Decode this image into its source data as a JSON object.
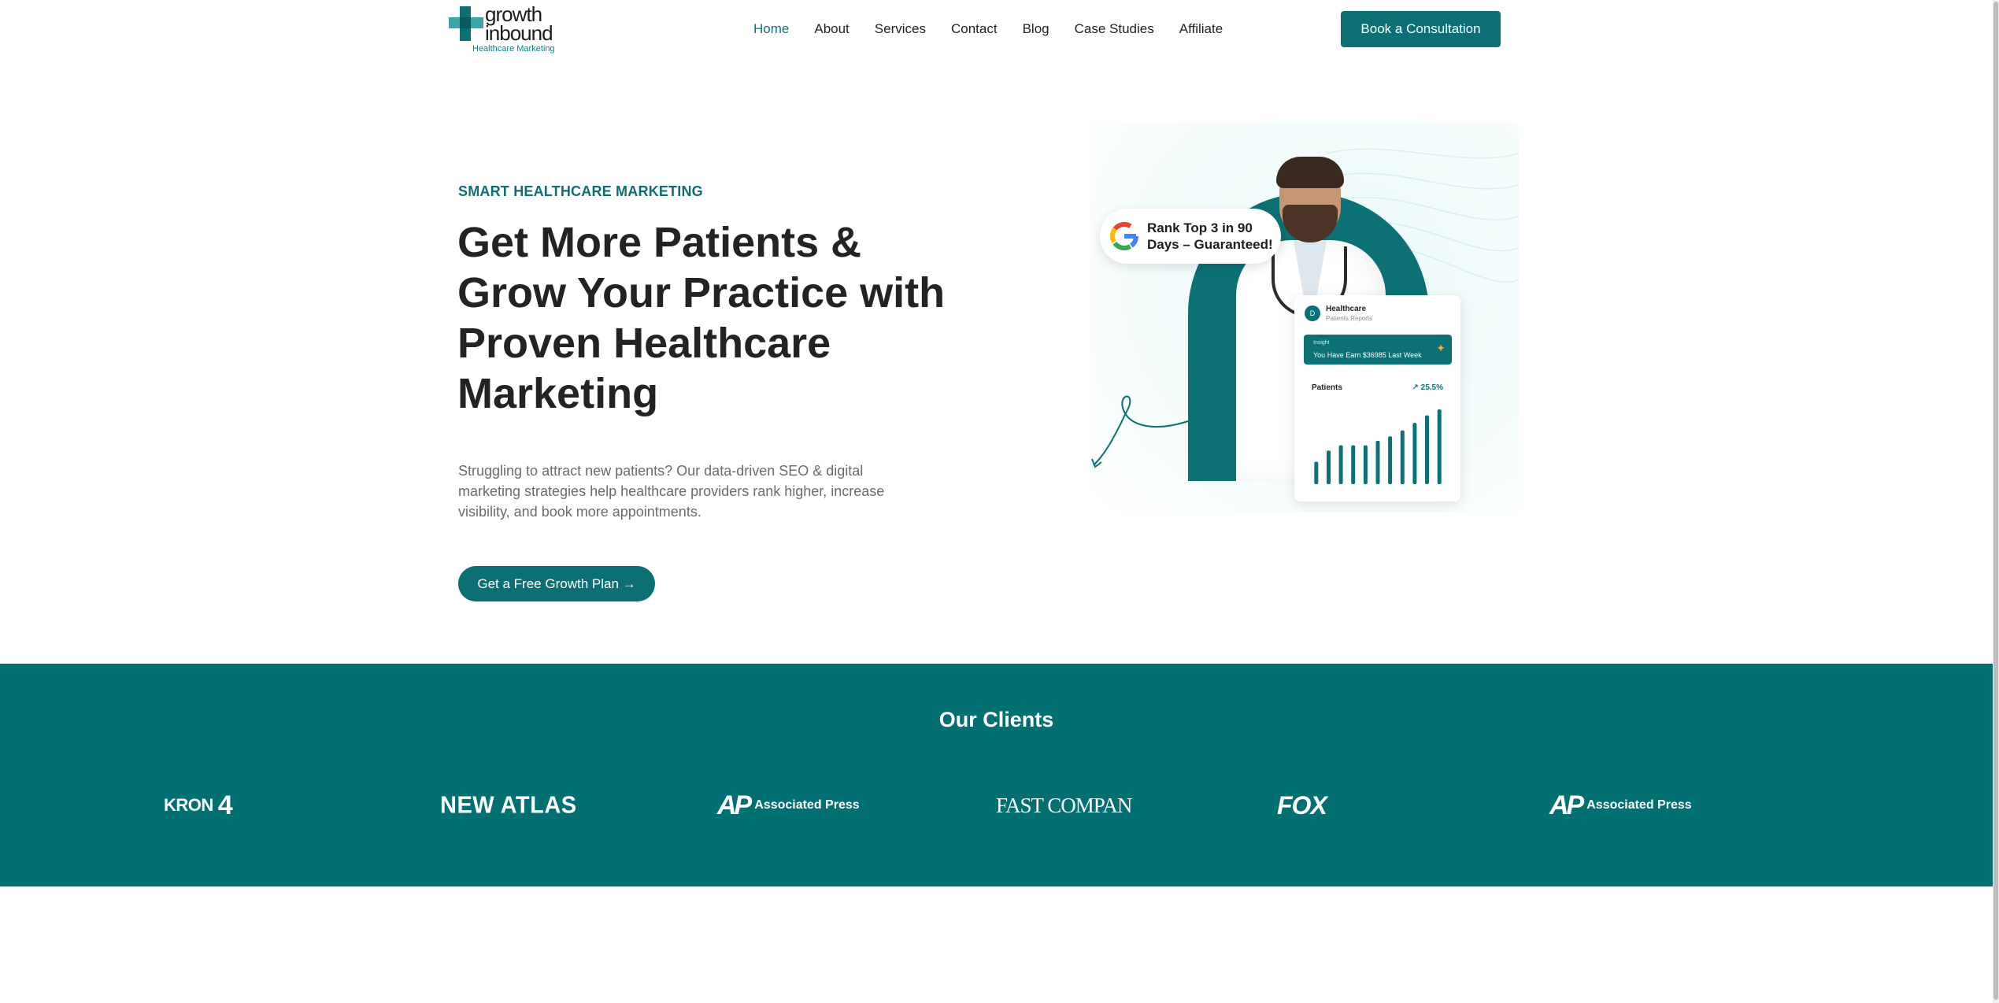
{
  "header": {
    "logo": {
      "word_line1": "growth",
      "word_line2": "inbound",
      "tagline": "Healthcare Marketing"
    },
    "nav": [
      {
        "label": "Home",
        "active": true
      },
      {
        "label": "About",
        "active": false
      },
      {
        "label": "Services",
        "active": false
      },
      {
        "label": "Contact",
        "active": false
      },
      {
        "label": "Blog",
        "active": false
      },
      {
        "label": "Case Studies",
        "active": false
      },
      {
        "label": "Affiliate",
        "active": false
      }
    ],
    "cta_label": "Book a Consultation"
  },
  "hero": {
    "eyebrow": "SMART HEALTHCARE MARKETING",
    "headline": "Get More Patients & Grow Your Practice with Proven Healthcare Marketing",
    "subtext": "Struggling to attract new patients? Our data-driven SEO & digital marketing strategies help healthcare providers rank higher, increase visibility, and book more appointments.",
    "cta_label": "Get a Free Growth Plan →",
    "image": {
      "rank_badge": "Rank Top 3 in 90 Days – Guaranteed!",
      "card": {
        "avatar_letter": "D",
        "title": "Healthcare",
        "subtitle": "Patients Reports",
        "insight_label": "Insight",
        "insight_value": "You Have Earn $36985 Last Week",
        "chart_label": "Patients",
        "growth": "↗ 25.5%",
        "bar_values": [
          30,
          45,
          52,
          52,
          52,
          58,
          64,
          72,
          82,
          92,
          100
        ]
      }
    }
  },
  "clients": {
    "heading": "Our Clients",
    "logos": [
      {
        "name": "KRON 4",
        "text": "KRON",
        "num": "4"
      },
      {
        "name": "NEW ATLAS",
        "text": "NEW ATLAS"
      },
      {
        "name": "Associated Press",
        "ap": "AP",
        "text": "Associated Press"
      },
      {
        "name": "FAST COMPANY",
        "text": "FAST COMPAN"
      },
      {
        "name": "FOX",
        "text": "FOX"
      },
      {
        "name": "Associated Press",
        "ap": "AP",
        "text": "Associated Press"
      }
    ]
  },
  "colors": {
    "brand_teal": "#0b6f74",
    "clients_band": "#027073",
    "nav_active": "#0f7378"
  }
}
